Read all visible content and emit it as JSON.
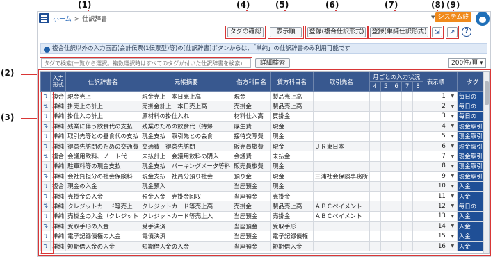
{
  "callouts": [
    "(1)",
    "(2)",
    "(3)",
    "(4)",
    "(5)",
    "(6)",
    "(7)",
    "(8)",
    "(9)"
  ],
  "breadcrumb": {
    "home": "ホーム",
    "separator": ">",
    "current": "仕訳辞書"
  },
  "header": {
    "end_button": "システム終了",
    "dropdown_arrow": "▼"
  },
  "toolbar": {
    "tag_confirm": "タグの確認",
    "display_order": "表示順",
    "register_composite": "登録(複合仕訳形式)",
    "register_simple": "登録(単純仕訳形式)",
    "expand_icon": "⇲",
    "popout_icon": "↗",
    "help_icon": "?"
  },
  "info": {
    "icon": "i",
    "message": "複合仕訳以外の入力画面(会計伝票(1伝票型)等)の[仕訳辞書]ボタンからは、「単純」の仕訳辞書のみ利用可能です"
  },
  "search": {
    "placeholder": "タグで検索(一覧から選択。複数選択時はすべてのタグが付いた仕訳辞書を検索)",
    "detail_button": "詳細検索"
  },
  "paging": {
    "per_page": "200件/頁 ▾"
  },
  "table": {
    "headers": {
      "input_type": "入力形式",
      "dict_name": "仕訳辞書名",
      "summary": "元帳摘要",
      "debit": "借方科目名",
      "credit": "貸方科目名",
      "partner": "取引先名",
      "monthly": "月ごとの入力状況",
      "months": [
        "4",
        "5",
        "6",
        "7",
        "8"
      ],
      "order": "表示順",
      "tag": "タグ"
    },
    "sort_icon": "⇅",
    "dropdown_icon": "▼",
    "rows": [
      {
        "type": "複合",
        "name": "現金売上",
        "summary": "現金売上　本日売上高",
        "debit": "現金",
        "credit": "製品売上高",
        "partner": "",
        "order": "1",
        "tag": "毎日の"
      },
      {
        "type": "単純",
        "name": "掛売上の計上",
        "summary": "売掛金計上　本日売上高",
        "debit": "売掛金",
        "credit": "製品売上高",
        "partner": "",
        "order": "2",
        "tag": "毎日の"
      },
      {
        "type": "単純",
        "name": "掛仕入の計上",
        "summary": "原材料の掛仕入れ",
        "debit": "材料仕入高",
        "credit": "買掛金",
        "partner": "",
        "order": "3",
        "tag": "毎日の"
      },
      {
        "type": "単純",
        "name": "残業に伴う飲食代の支払",
        "summary": "残業のための飲食代（持帰",
        "debit": "厚生費",
        "credit": "現金",
        "partner": "",
        "order": "4",
        "tag": "現金取引"
      },
      {
        "type": "単純",
        "name": "取引先等との昼食代の支払",
        "summary": "現金支払　取引先との会食",
        "debit": "接待交際費",
        "credit": "現金",
        "partner": "",
        "order": "5",
        "tag": "現金取引"
      },
      {
        "type": "単純",
        "name": "得意先訪問のための交通費",
        "summary": "交通費　得意先訪問",
        "debit": "販売員旅費",
        "credit": "現金",
        "partner": "ＪＲ東日本",
        "order": "6",
        "tag": "現金取引"
      },
      {
        "type": "複合",
        "name": "会議用飲料、ノート代",
        "summary": "未払計上　会議用飲料の購入",
        "debit": "会議費",
        "credit": "未払金",
        "partner": "",
        "order": "7",
        "tag": "現金取引"
      },
      {
        "type": "単純",
        "name": "駐車料等の現金支払",
        "summary": "現金支払　パーキングメータ等料",
        "debit": "販売員旅費",
        "credit": "現金",
        "partner": "",
        "order": "8",
        "tag": "現金取引"
      },
      {
        "type": "単純",
        "name": "会社負担分の社会保険料",
        "summary": "現金支払　社員分預り社会",
        "debit": "預り金",
        "credit": "現金",
        "partner": "三浦社会保険事務所",
        "order": "9",
        "tag": "現金取引"
      },
      {
        "type": "複合",
        "name": "現金の入金",
        "summary": "現金預入",
        "debit": "当座預金",
        "credit": "現金",
        "partner": "",
        "order": "10",
        "tag": "入金"
      },
      {
        "type": "単純",
        "name": "売掛金の入金",
        "summary": "預金入金　売掛金回収",
        "debit": "当座預金",
        "credit": "売掛金",
        "partner": "",
        "order": "11",
        "tag": "入金"
      },
      {
        "type": "単純",
        "name": "クレジットカード等売上",
        "summary": "クレジットカード等売上高",
        "debit": "売掛金",
        "credit": "製品売上高",
        "partner": "ＡＢＣペイメント",
        "order": "12",
        "tag": "毎日の"
      },
      {
        "type": "単純",
        "name": "売掛金の入金（クレジット",
        "summary": "クレジットカード等売上入",
        "debit": "当座預金",
        "credit": "売掛金",
        "partner": "ＡＢＣペイメント",
        "order": "13",
        "tag": "入金"
      },
      {
        "type": "単純",
        "name": "受取手形の入金",
        "summary": "受手決済",
        "debit": "当座預金",
        "credit": "受取手形",
        "partner": "",
        "order": "14",
        "tag": "入金"
      },
      {
        "type": "単純",
        "name": "電子記録債権の入金",
        "summary": "電債決済",
        "debit": "当座預金",
        "credit": "電子記録債権",
        "partner": "",
        "order": "15",
        "tag": "入金"
      },
      {
        "type": "単純",
        "name": "短期借入金の入金",
        "summary": "短期借入金の入金",
        "debit": "当座預金",
        "credit": "短期借入金",
        "partner": "",
        "order": "16",
        "tag": "入金"
      }
    ]
  }
}
